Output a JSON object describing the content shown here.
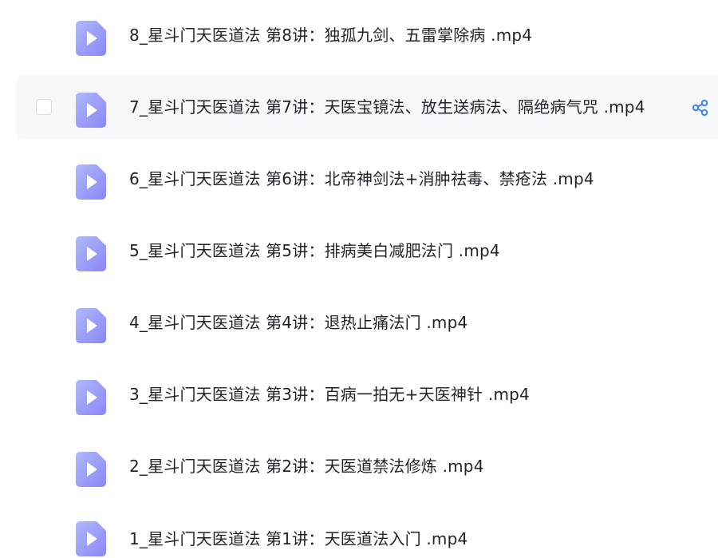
{
  "files": [
    {
      "name": "8_星斗门天医道法 第8讲：独孤九剑、五雷掌除病 .mp4",
      "icon": "video-file-icon"
    },
    {
      "name": "7_星斗门天医道法 第7讲：天医宝镜法、放生送病法、隔绝病气咒 .mp4",
      "icon": "video-file-icon",
      "hovered": true
    },
    {
      "name": "6_星斗门天医道法 第6讲：北帝神剑法+消肿祛毒、禁疮法 .mp4",
      "icon": "video-file-icon"
    },
    {
      "name": "5_星斗门天医道法 第5讲：排病美白减肥法门 .mp4",
      "icon": "video-file-icon"
    },
    {
      "name": "4_星斗门天医道法 第4讲：退热止痛法门 .mp4",
      "icon": "video-file-icon"
    },
    {
      "name": "3_星斗门天医道法 第3讲：百病一拍无+天医神针 .mp4",
      "icon": "video-file-icon"
    },
    {
      "name": "2_星斗门天医道法 第2讲：天医道禁法修炼 .mp4",
      "icon": "video-file-icon"
    },
    {
      "name": "1_星斗门天医道法 第1讲：天医道法入门 .mp4",
      "icon": "video-file-icon"
    }
  ],
  "colors": {
    "icon_start": "#a7b3fb",
    "icon_end": "#8f8cf5",
    "share_icon": "#3b82f6",
    "hover_bg": "#f7f8fa"
  }
}
